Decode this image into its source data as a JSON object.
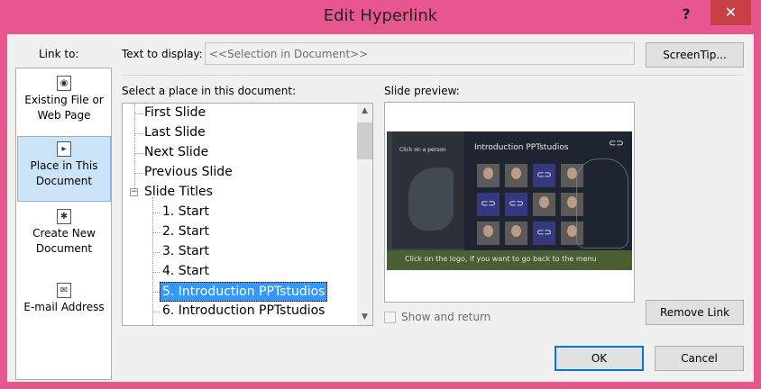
{
  "window": {
    "title": "Edit Hyperlink",
    "help_glyph": "?",
    "close_glyph": "✕"
  },
  "link_to": {
    "label": "Link to:",
    "items": [
      {
        "label": "Existing File or\nWeb Page",
        "icon": "web-page-icon",
        "selected": false
      },
      {
        "label": "Place in This\nDocument",
        "icon": "place-in-document-icon",
        "selected": true
      },
      {
        "label": "Create New\nDocument",
        "icon": "new-document-icon",
        "selected": false
      },
      {
        "label": "E-mail Address",
        "icon": "email-icon",
        "selected": false
      }
    ]
  },
  "text_to_display": {
    "label": "Text to display:",
    "value": "<<Selection in Document>>"
  },
  "screentip_button": "ScreenTip...",
  "place_select": {
    "label": "Select a place in this document:",
    "items": [
      {
        "label": "First Slide",
        "level": 0
      },
      {
        "label": "Last Slide",
        "level": 0
      },
      {
        "label": "Next Slide",
        "level": 0
      },
      {
        "label": "Previous Slide",
        "level": 0
      },
      {
        "label": "Slide Titles",
        "level": 0,
        "expanded": true
      },
      {
        "label": "1. Start",
        "level": 1
      },
      {
        "label": "2. Start",
        "level": 1
      },
      {
        "label": "3. Start",
        "level": 1
      },
      {
        "label": "4. Start",
        "level": 1
      },
      {
        "label": "5. Introduction PPTstudios",
        "level": 1,
        "selected": true
      },
      {
        "label": "6. Introduction PPTstudios",
        "level": 1
      }
    ]
  },
  "slide_preview": {
    "label": "Slide preview:",
    "slide_click_text": "Click on a person",
    "slide_title": "Introduction PPTstudios",
    "slide_footer": "Click on the logo, if you want to go back to the menu"
  },
  "show_and_return": {
    "label": "Show and return",
    "checked": false
  },
  "remove_link_button": "Remove Link",
  "ok_button": "OK",
  "cancel_button": "Cancel",
  "colors": {
    "title_bar": "#e8568f",
    "close_button": "#c74045",
    "selection": "#3399ff",
    "link_to_selected": "#cce4f7"
  }
}
